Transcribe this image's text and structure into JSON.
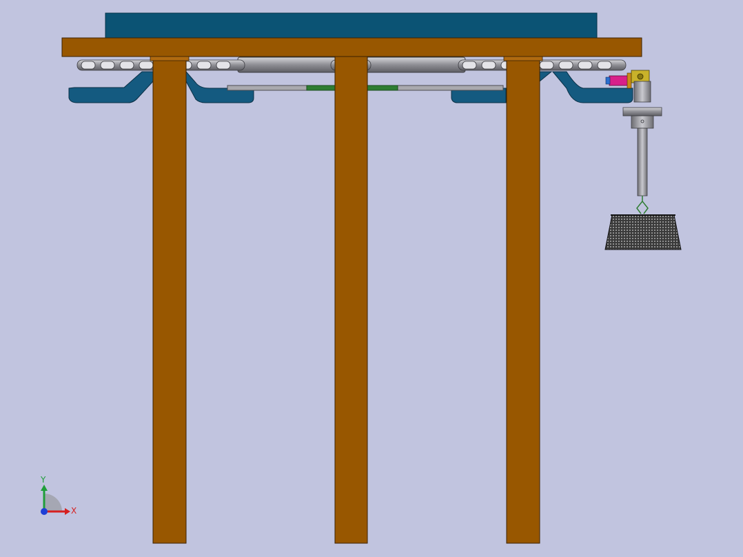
{
  "axis_triad": {
    "y_label": "Y",
    "x_label": "X",
    "y_color": "#1f9e3a",
    "x_color": "#d62020",
    "z_color": "#1f3fd6"
  },
  "colors": {
    "background": "#c1c4df",
    "wood": "#985700",
    "top_panel": "#0b5374",
    "bracket": "#145a80",
    "steel": "#9a9a9e",
    "green_rod": "#2e7d32",
    "basket": "#2a2a2a",
    "clamp": "#c9b22a",
    "spring": "#d8208a"
  }
}
